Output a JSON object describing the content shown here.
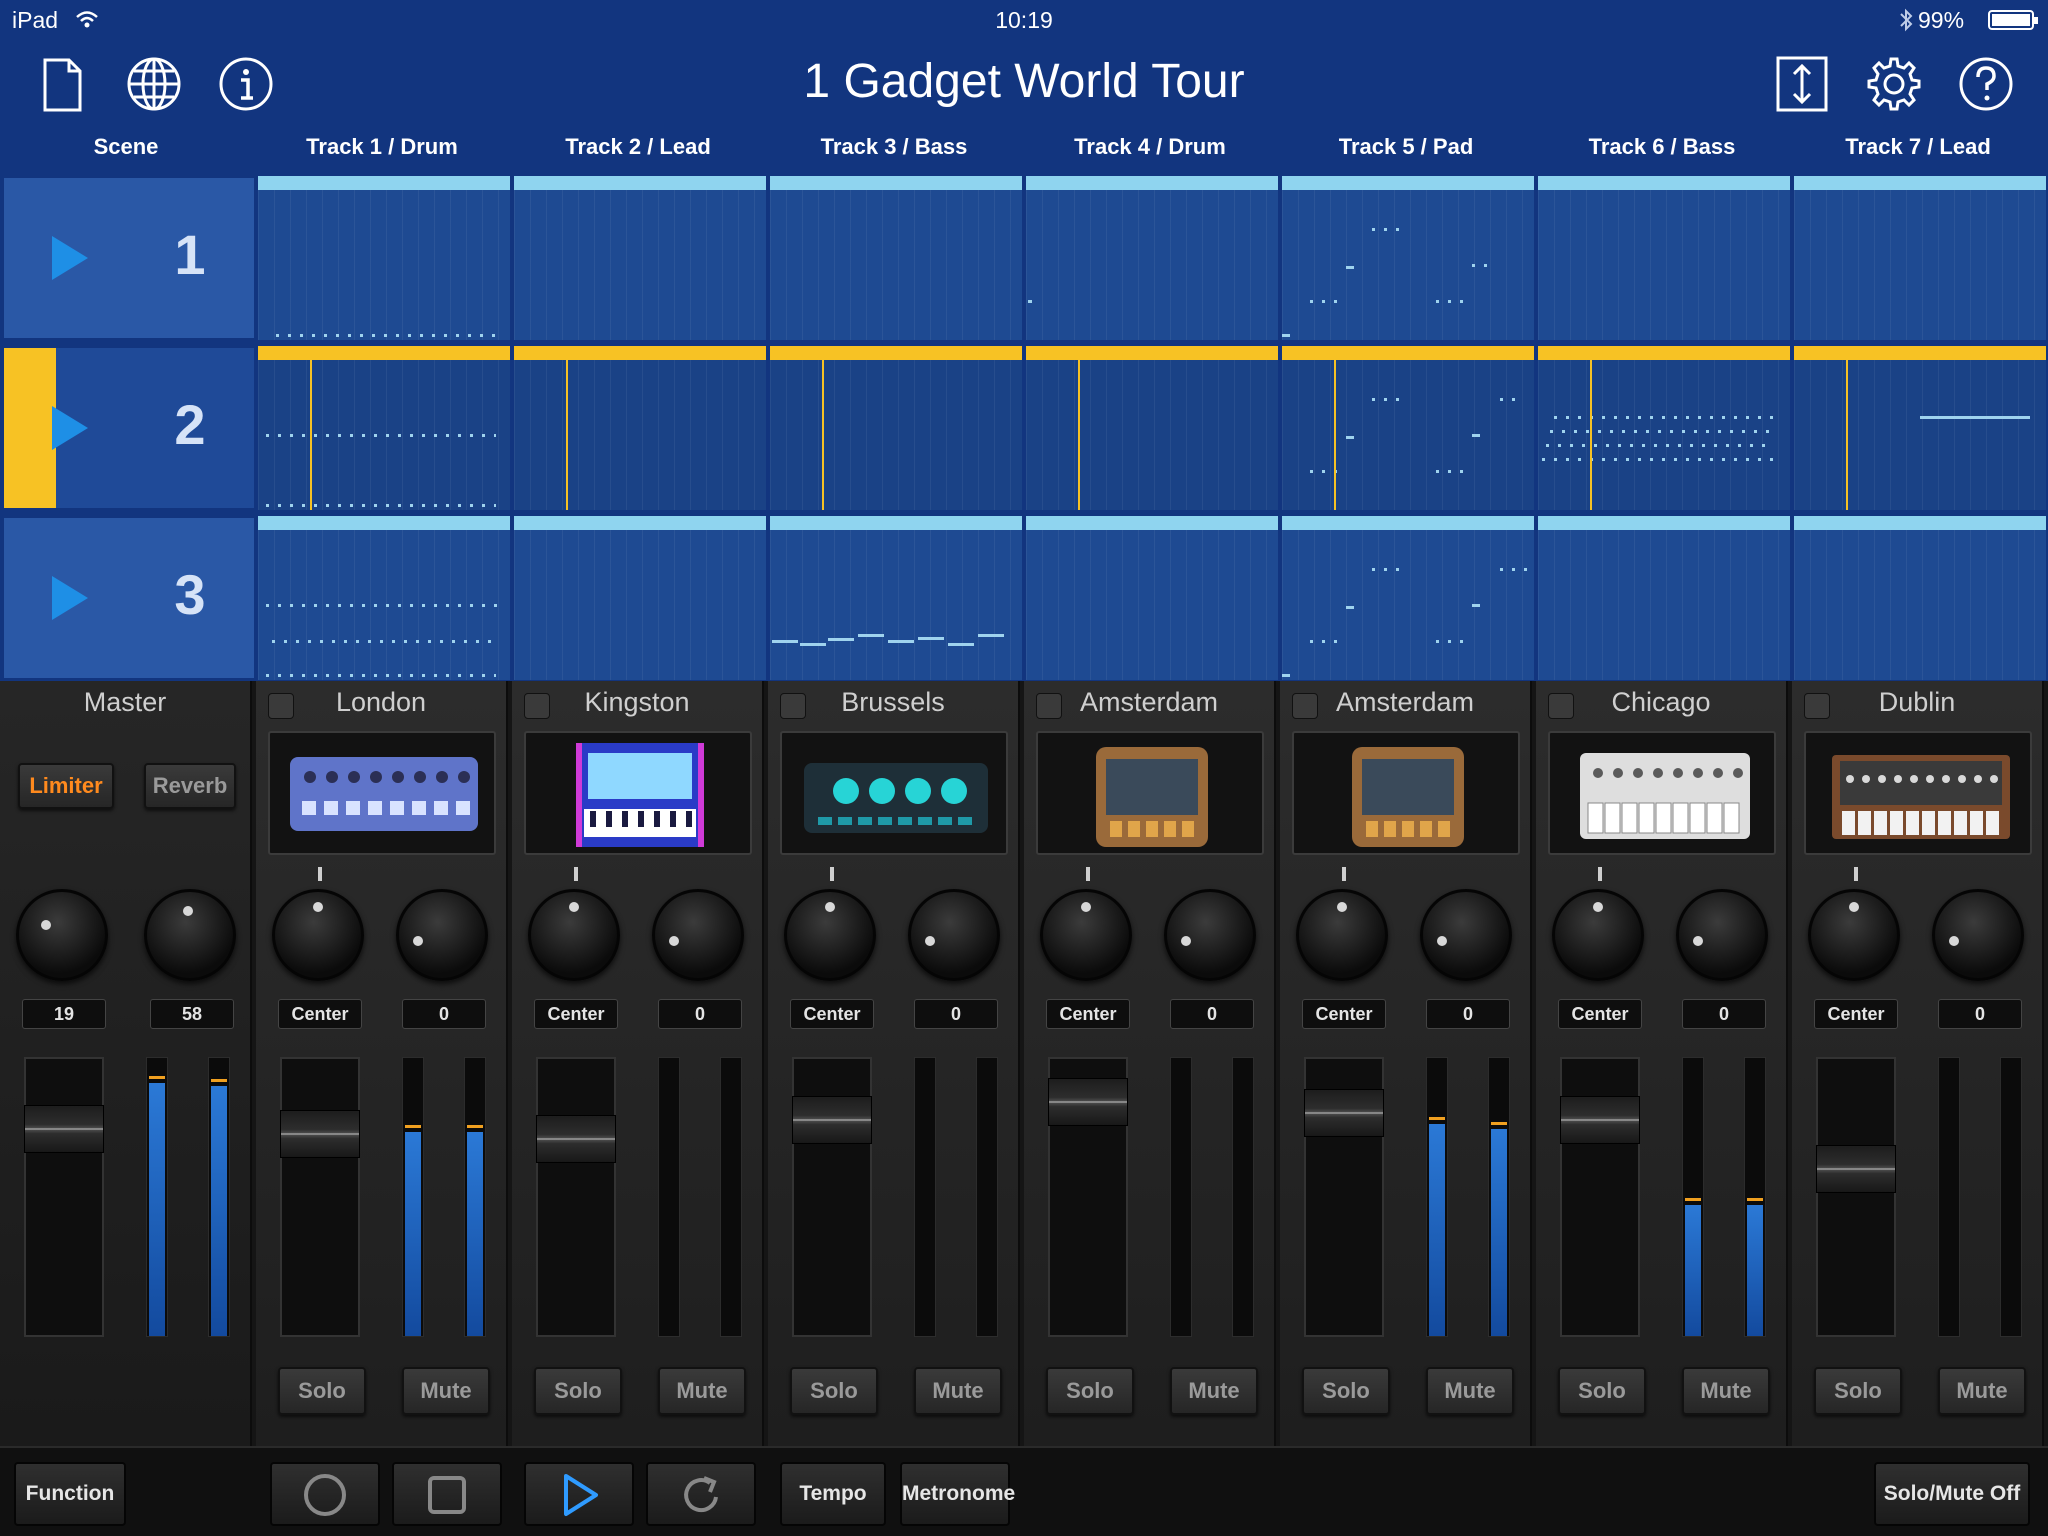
{
  "status_bar": {
    "device": "iPad",
    "time": "10:19",
    "battery": "99%",
    "bluetooth_icon": "bluetooth-icon",
    "wifi_icon": "wifi-icon"
  },
  "header": {
    "title": "1 Gadget World Tour",
    "left_icons": [
      "new-document-icon",
      "globe-icon",
      "info-icon"
    ],
    "right_icons": [
      "expand-vertical-icon",
      "gear-icon",
      "help-icon"
    ]
  },
  "scene_header": "Scene",
  "tracks": [
    {
      "name": "Track 1 / Drum",
      "gadget": "London"
    },
    {
      "name": "Track 2 / Lead",
      "gadget": "Kingston"
    },
    {
      "name": "Track 3 / Bass",
      "gadget": "Brussels"
    },
    {
      "name": "Track 4 / Drum",
      "gadget": "Amsterdam"
    },
    {
      "name": "Track 5 / Pad",
      "gadget": "Amsterdam"
    },
    {
      "name": "Track 6 / Bass",
      "gadget": "Chicago"
    },
    {
      "name": "Track 7 / Lead",
      "gadget": "Dublin"
    }
  ],
  "scenes": [
    {
      "number": "1",
      "playing": false
    },
    {
      "number": "2",
      "playing": true
    },
    {
      "number": "3",
      "playing": false
    }
  ],
  "master": {
    "name": "Master",
    "limiter_label": "Limiter",
    "reverb_label": "Reverb",
    "limiter_on": true,
    "knob_values": [
      "19",
      "58"
    ],
    "fader_level": 0.8,
    "meter_levels": [
      0.93,
      0.92
    ]
  },
  "channel_strip": {
    "pan_value": "Center",
    "send_value": "0",
    "solo_label": "Solo",
    "mute_label": "Mute",
    "fader_levels": [
      0.78,
      0.76,
      0.84,
      0.92,
      0.87,
      0.84,
      0.63
    ],
    "meter_levels": [
      [
        0.75,
        0.75
      ],
      [
        0,
        0
      ],
      [
        0,
        0
      ],
      [
        0,
        0
      ],
      [
        0.78,
        0.76
      ],
      [
        0.48,
        0.48
      ],
      [
        0,
        0
      ]
    ]
  },
  "toolbar": {
    "function_label": "Function",
    "tempo_label": "Tempo",
    "metronome_label": "Metronome",
    "solo_mute_label": "Solo/Mute Off",
    "transport_icons": [
      "record-icon",
      "stop-icon",
      "play-icon",
      "loop-icon"
    ]
  }
}
